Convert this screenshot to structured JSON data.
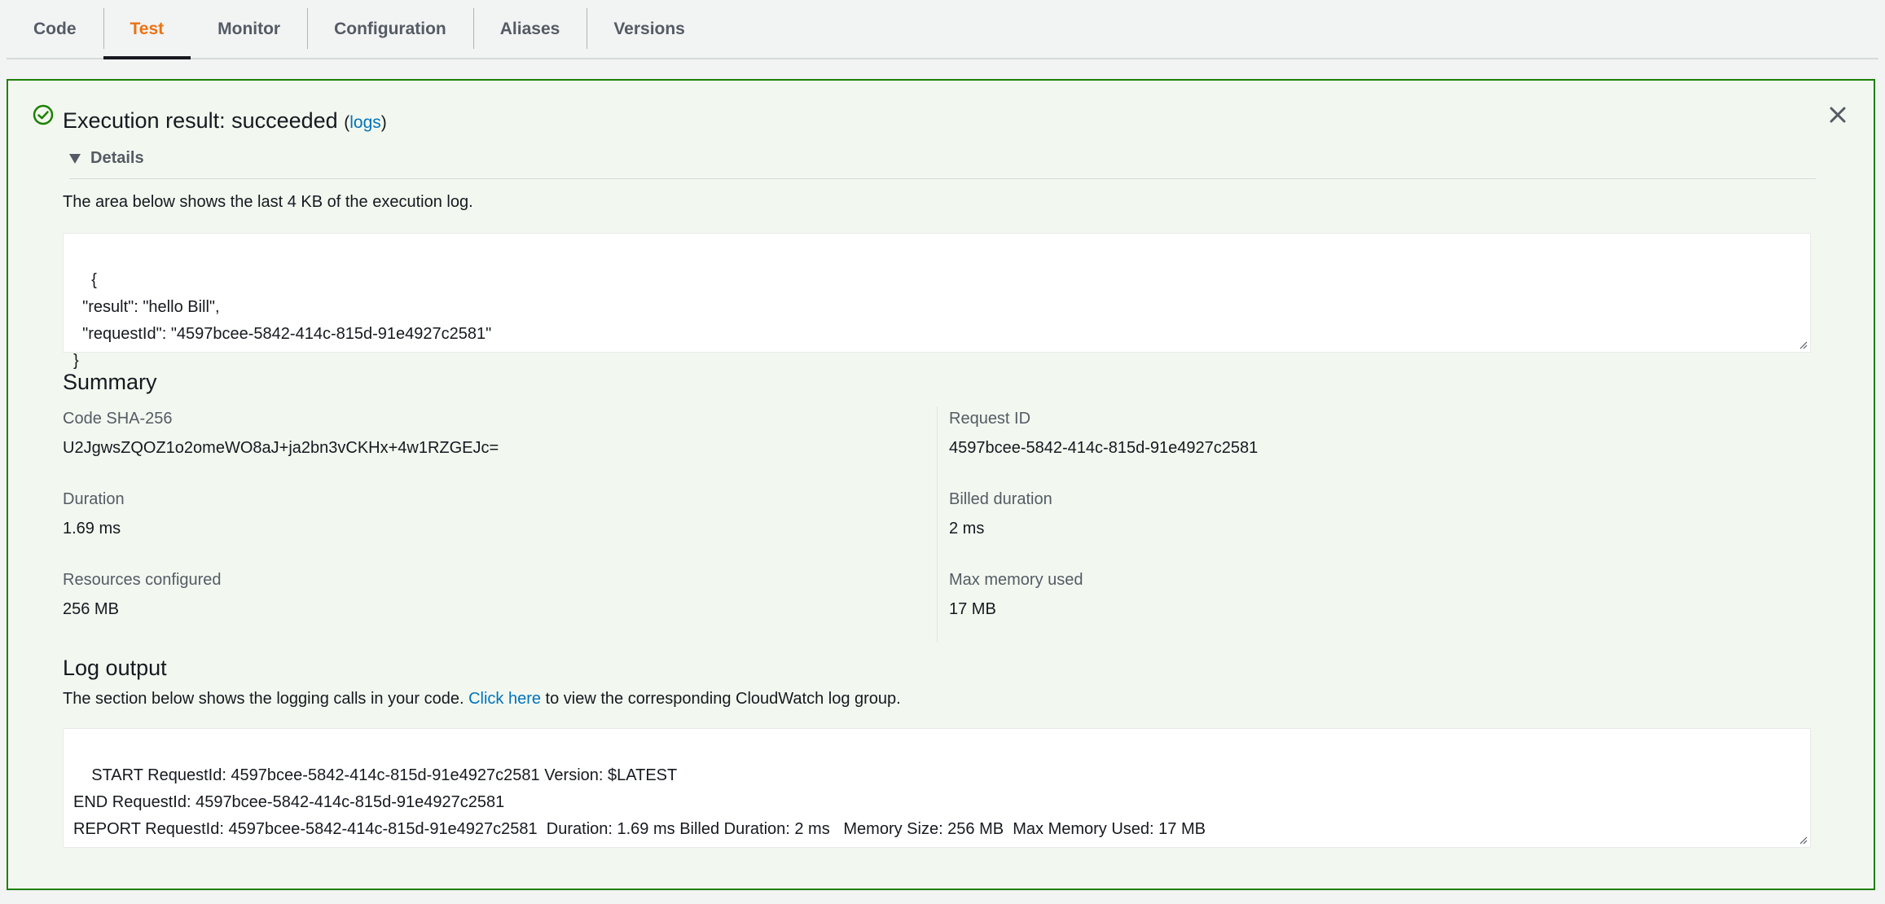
{
  "tabs": [
    {
      "label": "Code",
      "active": false
    },
    {
      "label": "Test",
      "active": true
    },
    {
      "label": "Monitor",
      "active": false
    },
    {
      "label": "Configuration",
      "active": false
    },
    {
      "label": "Aliases",
      "active": false
    },
    {
      "label": "Versions",
      "active": false
    }
  ],
  "result": {
    "title": "Execution result: succeeded",
    "paren_open": "(",
    "logs_link": "logs",
    "paren_close": ")",
    "status_icon": "check-circle-icon",
    "close_icon": "close-icon"
  },
  "details": {
    "toggle_label": "Details",
    "description": "The area below shows the last 4 KB of the execution log.",
    "output": "{\n  \"result\": \"hello Bill\",\n  \"requestId\": \"4597bcee-5842-414c-815d-91e4927c2581\"\n}"
  },
  "summary": {
    "title": "Summary",
    "left": [
      {
        "label": "Code SHA-256",
        "value": "U2JgwsZQOZ1o2omeWO8aJ+ja2bn3vCKHx+4w1RZGEJc="
      },
      {
        "label": "Duration",
        "value": "1.69 ms"
      },
      {
        "label": "Resources configured",
        "value": "256 MB"
      }
    ],
    "right": [
      {
        "label": "Request ID",
        "value": "4597bcee-5842-414c-815d-91e4927c2581"
      },
      {
        "label": "Billed duration",
        "value": "2 ms"
      },
      {
        "label": "Max memory used",
        "value": "17 MB"
      }
    ]
  },
  "log_output": {
    "title": "Log output",
    "desc_before": "The section below shows the logging calls in your code. ",
    "link": "Click here",
    "desc_after": " to view the corresponding CloudWatch log group.",
    "text": "START RequestId: 4597bcee-5842-414c-815d-91e4927c2581 Version: $LATEST\nEND RequestId: 4597bcee-5842-414c-815d-91e4927c2581\nREPORT RequestId: 4597bcee-5842-414c-815d-91e4927c2581  Duration: 1.69 ms Billed Duration: 2 ms   Memory Size: 256 MB  Max Memory Used: 17 MB"
  },
  "colors": {
    "accent": "#ec7211",
    "success": "#1d8102",
    "link": "#0073bb"
  }
}
